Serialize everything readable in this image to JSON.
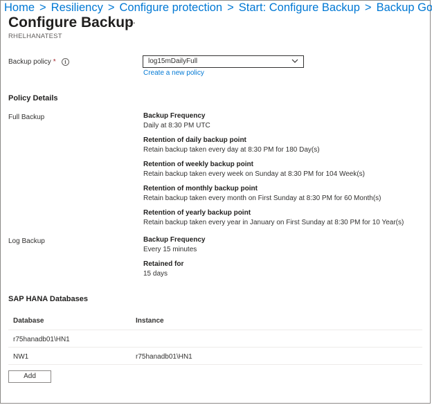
{
  "breadcrumb": [
    {
      "label": "Home"
    },
    {
      "label": "Resiliency"
    },
    {
      "label": "Configure protection"
    },
    {
      "label": "Start: Configure Backup"
    },
    {
      "label": "Backup Goal"
    }
  ],
  "breadcrumb_separator": ">",
  "header": {
    "title": "Configure Backup",
    "more": "···",
    "subtitle": "RHELHANATEST"
  },
  "backup_policy": {
    "label": "Backup policy",
    "required_mark": "*",
    "info_glyph": "i",
    "selected": "log15mDailyFull",
    "create_link": "Create a new policy"
  },
  "policy_details": {
    "heading": "Policy Details",
    "full_backup": {
      "label": "Full Backup",
      "items": [
        {
          "title": "Backup Frequency",
          "value": "Daily at 8:30 PM UTC"
        },
        {
          "title": "Retention of daily backup point",
          "value": "Retain backup taken every day at 8:30 PM for 180 Day(s)"
        },
        {
          "title": "Retention of weekly backup point",
          "value": "Retain backup taken every week on Sunday at 8:30 PM for 104 Week(s)"
        },
        {
          "title": "Retention of monthly backup point",
          "value": "Retain backup taken every month on First Sunday at 8:30 PM for 60 Month(s)"
        },
        {
          "title": "Retention of yearly backup point",
          "value": "Retain backup taken every year in January on First Sunday at 8:30 PM for 10 Year(s)"
        }
      ]
    },
    "log_backup": {
      "label": "Log Backup",
      "items": [
        {
          "title": "Backup Frequency",
          "value": "Every 15 minutes"
        },
        {
          "title": "Retained for",
          "value": "15 days"
        }
      ]
    }
  },
  "databases": {
    "heading": "SAP HANA Databases",
    "columns": [
      "Database",
      "Instance"
    ],
    "rows": [
      {
        "database": "r75hanadb01\\HN1",
        "instance": ""
      },
      {
        "database": "NW1",
        "instance": "r75hanadb01\\HN1"
      }
    ],
    "add_label": "Add"
  },
  "colors": {
    "link": "#0078d4",
    "text": "#323130",
    "required": "#a4262c",
    "divider": "#edebe9"
  },
  "icons": {
    "info": "info-icon",
    "dropdown": "chevron-down-icon",
    "more": "more-icon"
  }
}
